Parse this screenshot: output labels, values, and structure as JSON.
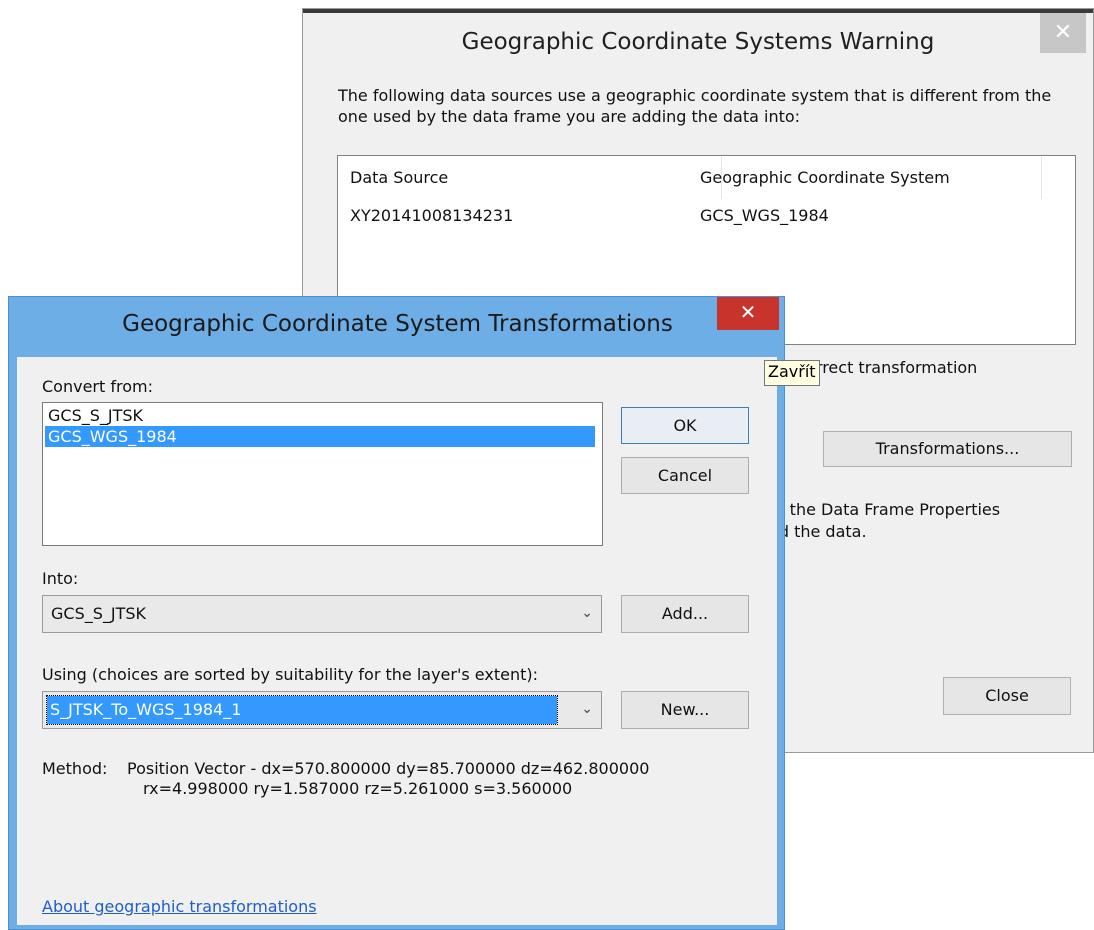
{
  "warning_dialog": {
    "title": "Geographic Coordinate Systems Warning",
    "close_glyph": "✕",
    "message": "The following data sources use a geographic coordinate system that is different from the one used by the data frame you are adding the data into:",
    "columns": [
      "Data Source",
      "Geographic Coordinate System"
    ],
    "rows": [
      {
        "data_source": "XY20141008134231",
        "gcs": "GCS_WGS_1984"
      }
    ],
    "partial_text_1": "s a correct transformation",
    "transformations_button": "Transformations...",
    "partial_text_2a": "m the Data Frame Properties",
    "partial_text_2b": "ed the data.",
    "close_button": "Close"
  },
  "transform_dialog": {
    "title": "Geographic Coordinate System Transformations",
    "close_glyph": "✕",
    "convert_from_label": "Convert from:",
    "convert_from_items": [
      "GCS_S_JTSK",
      "GCS_WGS_1984"
    ],
    "selected_item": "GCS_WGS_1984",
    "ok_button": "OK",
    "cancel_button": "Cancel",
    "into_label": "Into:",
    "into_value": "GCS_S_JTSK",
    "add_button": "Add...",
    "using_label": "Using (choices are sorted by suitability for the layer's extent):",
    "using_value": "S_JTSK_To_WGS_1984_1",
    "new_button": "New...",
    "method_label": "Method:",
    "method_line1": "Position Vector - dx=570.800000 dy=85.700000 dz=462.800000",
    "method_line2": "rx=4.998000 ry=1.587000 rz=5.261000 s=3.560000",
    "about_link": "About geographic transformations"
  },
  "tooltip": "Zavřít",
  "colors": {
    "title_bar_active": "#6eaee6",
    "close_active": "#c8332b",
    "selection": "#3399ff",
    "link": "#1f5ec9"
  }
}
